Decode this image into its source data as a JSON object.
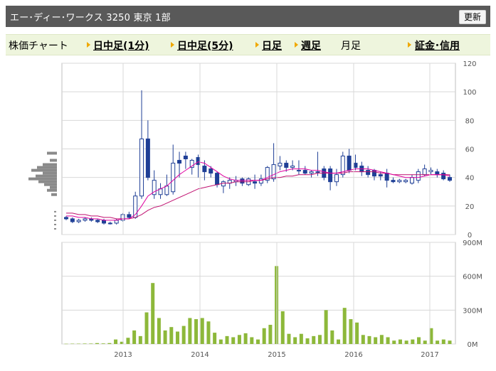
{
  "header": {
    "title": "エー･ディー･ワークス  3250  東京 1部",
    "refresh_label": "更新"
  },
  "tabs": [
    {
      "label": "株価チャート",
      "kind": "plain"
    },
    {
      "label": "日中足(1分)",
      "kind": "link"
    },
    {
      "label": "日中足(5分)",
      "kind": "link"
    },
    {
      "label": "日足",
      "kind": "link"
    },
    {
      "label": "週足",
      "kind": "link"
    },
    {
      "label": "月足",
      "kind": "plain"
    },
    {
      "label": "証金･信用",
      "kind": "link"
    }
  ],
  "colors": {
    "titlebar": "#595959",
    "tabs_bg": "#eef5dd",
    "arrow": "#f0a800",
    "candle_down": "#1f3f96",
    "candle_up_border": "#1f3f96",
    "ma_short": "#e000a0",
    "ma_long": "#c01070",
    "volume_bar": "#8db83a"
  },
  "chart_data": [
    {
      "type": "candlestick",
      "title": "",
      "x_ticks": [
        "2013",
        "2014",
        "2015",
        "2016",
        "2017"
      ],
      "y_ticks": [
        "0",
        "20",
        "40",
        "60",
        "80",
        "100",
        "120"
      ],
      "ylim": [
        0,
        120
      ],
      "grid": true,
      "candles": [
        {
          "o": 12,
          "h": 13,
          "l": 10,
          "c": 11
        },
        {
          "o": 11,
          "h": 12,
          "l": 8,
          "c": 9
        },
        {
          "o": 9,
          "h": 11,
          "l": 8,
          "c": 10
        },
        {
          "o": 10,
          "h": 12,
          "l": 9,
          "c": 11
        },
        {
          "o": 11,
          "h": 12,
          "l": 9,
          "c": 10
        },
        {
          "o": 10,
          "h": 11,
          "l": 8,
          "c": 9
        },
        {
          "o": 10,
          "h": 11,
          "l": 7,
          "c": 8
        },
        {
          "o": 8,
          "h": 9,
          "l": 7,
          "c": 8
        },
        {
          "o": 8,
          "h": 11,
          "l": 7,
          "c": 10
        },
        {
          "o": 10,
          "h": 15,
          "l": 9,
          "c": 14
        },
        {
          "o": 14,
          "h": 16,
          "l": 11,
          "c": 12
        },
        {
          "o": 12,
          "h": 30,
          "l": 11,
          "c": 27
        },
        {
          "o": 27,
          "h": 101,
          "l": 25,
          "c": 67
        },
        {
          "o": 67,
          "h": 80,
          "l": 38,
          "c": 40
        },
        {
          "o": 28,
          "h": 45,
          "l": 25,
          "c": 38
        },
        {
          "o": 28,
          "h": 36,
          "l": 25,
          "c": 32
        },
        {
          "o": 28,
          "h": 42,
          "l": 27,
          "c": 34
        },
        {
          "o": 30,
          "h": 63,
          "l": 28,
          "c": 50
        },
        {
          "o": 52,
          "h": 58,
          "l": 40,
          "c": 50
        },
        {
          "o": 55,
          "h": 58,
          "l": 46,
          "c": 53
        },
        {
          "o": 47,
          "h": 53,
          "l": 42,
          "c": 52
        },
        {
          "o": 54,
          "h": 56,
          "l": 40,
          "c": 49
        },
        {
          "o": 48,
          "h": 52,
          "l": 38,
          "c": 44
        },
        {
          "o": 46,
          "h": 48,
          "l": 40,
          "c": 43
        },
        {
          "o": 43,
          "h": 44,
          "l": 33,
          "c": 35
        },
        {
          "o": 34,
          "h": 38,
          "l": 29,
          "c": 37
        },
        {
          "o": 36,
          "h": 40,
          "l": 32,
          "c": 38
        },
        {
          "o": 37,
          "h": 41,
          "l": 34,
          "c": 38
        },
        {
          "o": 39,
          "h": 40,
          "l": 34,
          "c": 36
        },
        {
          "o": 35,
          "h": 40,
          "l": 34,
          "c": 39
        },
        {
          "o": 37,
          "h": 42,
          "l": 32,
          "c": 36
        },
        {
          "o": 36,
          "h": 42,
          "l": 34,
          "c": 39
        },
        {
          "o": 38,
          "h": 48,
          "l": 36,
          "c": 47
        },
        {
          "o": 39,
          "h": 64,
          "l": 37,
          "c": 49
        },
        {
          "o": 48,
          "h": 55,
          "l": 45,
          "c": 50
        },
        {
          "o": 50,
          "h": 52,
          "l": 44,
          "c": 47
        },
        {
          "o": 47,
          "h": 52,
          "l": 45,
          "c": 48
        },
        {
          "o": 45,
          "h": 52,
          "l": 42,
          "c": 45
        },
        {
          "o": 45,
          "h": 48,
          "l": 42,
          "c": 43
        },
        {
          "o": 43,
          "h": 45,
          "l": 40,
          "c": 44
        },
        {
          "o": 44,
          "h": 58,
          "l": 41,
          "c": 44
        },
        {
          "o": 46,
          "h": 48,
          "l": 38,
          "c": 40
        },
        {
          "o": 46,
          "h": 48,
          "l": 31,
          "c": 37
        },
        {
          "o": 37,
          "h": 46,
          "l": 34,
          "c": 42
        },
        {
          "o": 42,
          "h": 58,
          "l": 40,
          "c": 55
        },
        {
          "o": 55,
          "h": 60,
          "l": 43,
          "c": 45
        },
        {
          "o": 50,
          "h": 56,
          "l": 45,
          "c": 47
        },
        {
          "o": 48,
          "h": 51,
          "l": 41,
          "c": 44
        },
        {
          "o": 45,
          "h": 48,
          "l": 40,
          "c": 42
        },
        {
          "o": 45,
          "h": 46,
          "l": 38,
          "c": 41
        },
        {
          "o": 42,
          "h": 44,
          "l": 38,
          "c": 41
        },
        {
          "o": 43,
          "h": 46,
          "l": 33,
          "c": 38
        },
        {
          "o": 38,
          "h": 40,
          "l": 36,
          "c": 37
        },
        {
          "o": 37,
          "h": 39,
          "l": 36,
          "c": 38
        },
        {
          "o": 37,
          "h": 39,
          "l": 36,
          "c": 38
        },
        {
          "o": 36,
          "h": 42,
          "l": 35,
          "c": 40
        },
        {
          "o": 38,
          "h": 46,
          "l": 36,
          "c": 44
        },
        {
          "o": 42,
          "h": 49,
          "l": 41,
          "c": 46
        },
        {
          "o": 44,
          "h": 47,
          "l": 42,
          "c": 45
        },
        {
          "o": 44,
          "h": 46,
          "l": 40,
          "c": 42
        },
        {
          "o": 43,
          "h": 45,
          "l": 38,
          "c": 39
        },
        {
          "o": 40,
          "h": 42,
          "l": 37,
          "c": 38
        }
      ],
      "ma_short": [
        13,
        13,
        12,
        12,
        11,
        11,
        10,
        10,
        10,
        11,
        11,
        14,
        20,
        27,
        30,
        32,
        34,
        38,
        42,
        45,
        48,
        51,
        50,
        47,
        44,
        41,
        39,
        38,
        38,
        38,
        38,
        38,
        40,
        42,
        44,
        45,
        46,
        46,
        46,
        45,
        45,
        44,
        43,
        43,
        44,
        45,
        46,
        46,
        46,
        45,
        44,
        43,
        42,
        41,
        40,
        40,
        40,
        41,
        42,
        42,
        42,
        41
      ],
      "ma_long": [
        15,
        15,
        14,
        14,
        13,
        13,
        12,
        12,
        11,
        11,
        11,
        12,
        14,
        17,
        19,
        20,
        22,
        24,
        26,
        28,
        30,
        32,
        33,
        34,
        35,
        36,
        36,
        37,
        37,
        37,
        38,
        38,
        39,
        40,
        40,
        41,
        41,
        42,
        42,
        42,
        43,
        43,
        43,
        43,
        43,
        44,
        44,
        44,
        44,
        44,
        43,
        43,
        42,
        42,
        42,
        42,
        42,
        42,
        42,
        42,
        42,
        42
      ]
    },
    {
      "type": "bar",
      "title": "",
      "y_ticks": [
        "0M",
        "300M",
        "600M",
        "900M"
      ],
      "ylim": [
        0,
        900
      ],
      "values": [
        2,
        3,
        3,
        4,
        4,
        8,
        5,
        8,
        40,
        20,
        55,
        120,
        70,
        280,
        540,
        230,
        120,
        150,
        110,
        160,
        230,
        220,
        230,
        200,
        100,
        40,
        70,
        60,
        80,
        95,
        60,
        40,
        140,
        170,
        690,
        290,
        90,
        60,
        90,
        50,
        70,
        80,
        300,
        120,
        40,
        320,
        220,
        190,
        80,
        70,
        60,
        80,
        60,
        30,
        40,
        30,
        40,
        60,
        30,
        140,
        30,
        40,
        30
      ]
    }
  ]
}
